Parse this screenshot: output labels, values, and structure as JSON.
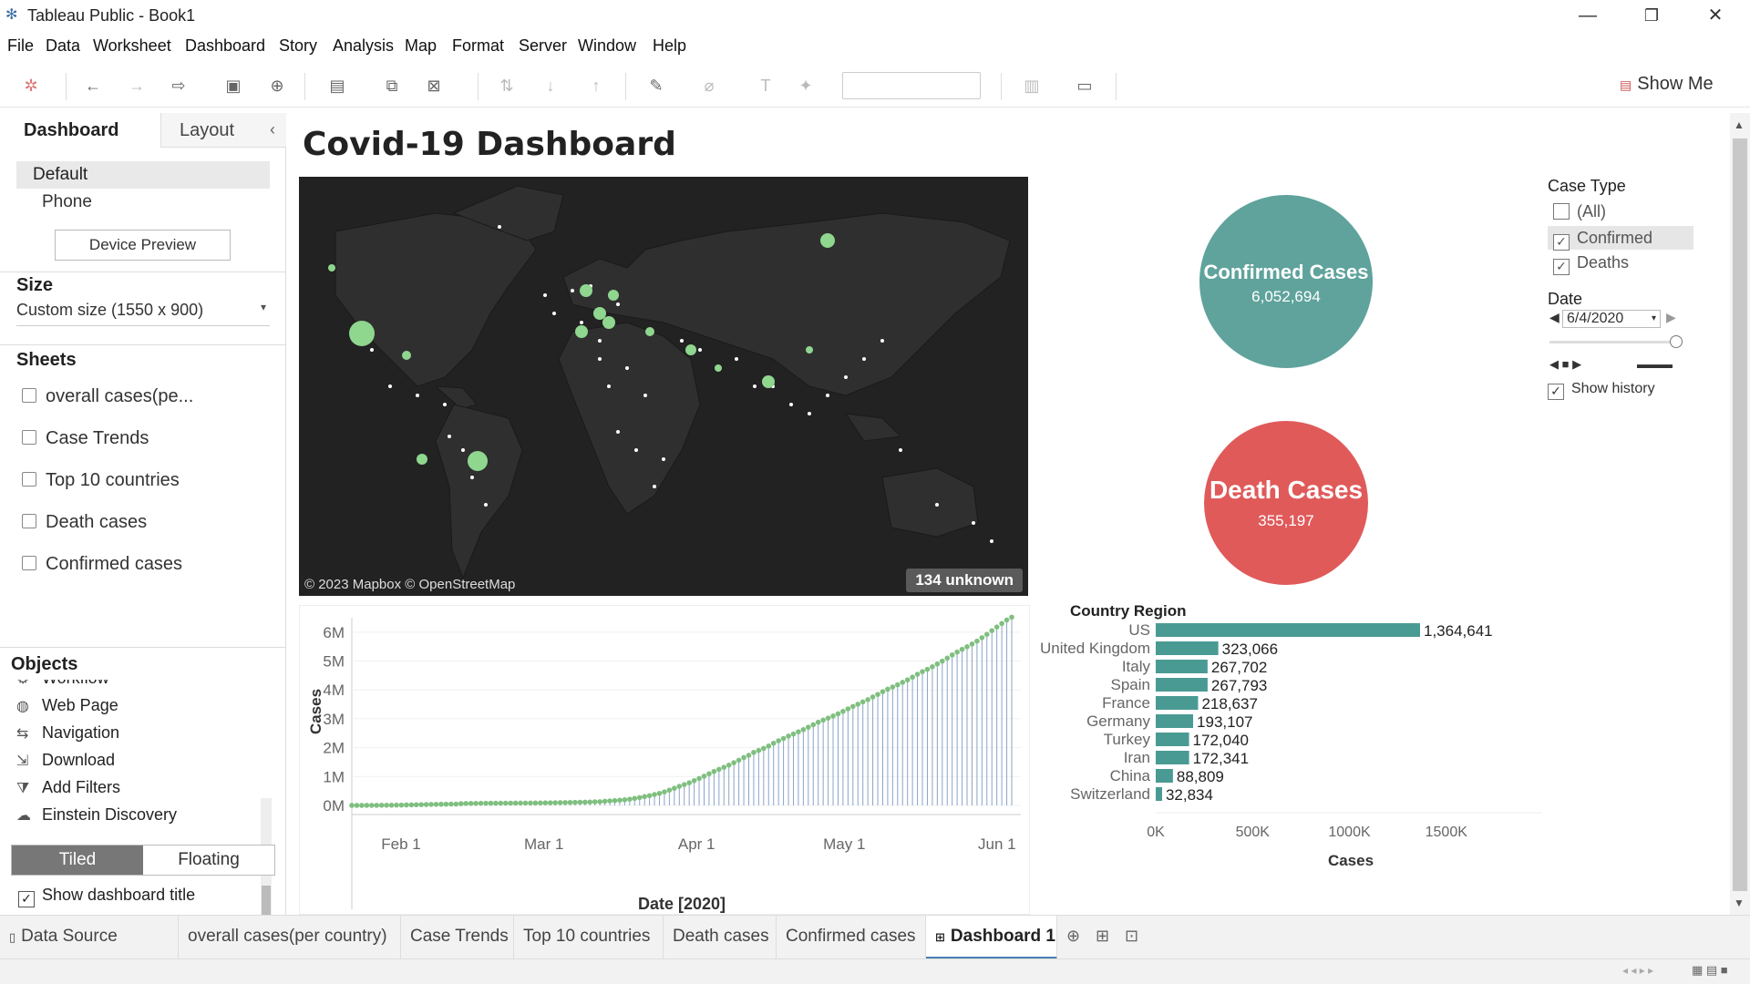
{
  "window": {
    "title": "Tableau Public - Book1",
    "minimize": "—",
    "restore": "❐",
    "close": "✕"
  },
  "menu": [
    "File",
    "Data",
    "Worksheet",
    "Dashboard",
    "Story",
    "Analysis",
    "Map",
    "Format",
    "Server",
    "Window",
    "Help"
  ],
  "toolbar": {
    "show_me": "Show Me"
  },
  "left_panel": {
    "tabs": {
      "dashboard": "Dashboard",
      "layout": "Layout",
      "collapse": "‹"
    },
    "devices": {
      "default": "Default",
      "phone": "Phone",
      "preview_button": "Device Preview"
    },
    "size": {
      "title": "Size",
      "value": "Custom size (1550 x 900)"
    },
    "sheets": {
      "title": "Sheets",
      "items": [
        "overall cases(pe...",
        "Case Trends",
        "Top 10 countries",
        "Death cases",
        "Confirmed cases"
      ]
    },
    "objects": {
      "title": "Objects",
      "items": [
        {
          "label": "Workflow",
          "icon": "workflow-icon"
        },
        {
          "label": "Web Page",
          "icon": "globe-icon"
        },
        {
          "label": "Navigation",
          "icon": "navigation-icon"
        },
        {
          "label": "Download",
          "icon": "download-icon"
        },
        {
          "label": "Add Filters",
          "icon": "filter-icon"
        },
        {
          "label": "Einstein Discovery",
          "icon": "einstein-icon"
        }
      ],
      "tiled": "Tiled",
      "floating": "Floating"
    },
    "show_title": {
      "label": "Show dashboard title",
      "checked": true
    }
  },
  "dashboard": {
    "title": "Covid-19 Dashboard",
    "map": {
      "attribution": "© 2023 Mapbox © OpenStreetMap",
      "unknown": "134 unknown"
    },
    "confirmed": {
      "label": "Confirmed Cases",
      "value": "6,052,694",
      "color": "#5fa39c"
    },
    "deaths": {
      "label": "Death Cases",
      "value": "355,197",
      "color": "#e05a5a"
    },
    "filters": {
      "case_type_title": "Case Type",
      "options": [
        {
          "label": "(All)",
          "checked": false
        },
        {
          "label": "Confirmed",
          "checked": true
        },
        {
          "label": "Deaths",
          "checked": true
        }
      ],
      "date_title": "Date",
      "date_value": "6/4/2020",
      "show_history": "Show history",
      "show_history_checked": true
    }
  },
  "chart_data": [
    {
      "type": "line",
      "ylabel": "Cases",
      "xlabel": "Date [2020]",
      "x_ticks": [
        "Feb 1",
        "Mar 1",
        "Apr 1",
        "May 1",
        "Jun 1"
      ],
      "y_ticks": [
        "0M",
        "1M",
        "2M",
        "3M",
        "4M",
        "5M",
        "6M"
      ],
      "ylim": [
        0,
        6500000
      ],
      "x_start": "2020-01-22",
      "x_end": "2020-06-04",
      "series": [
        {
          "color": "#7fbf7f",
          "values": [
            555,
            654,
            941,
            1434,
            2118,
            2927,
            5578,
            6166,
            8234,
            9927,
            12038,
            16787,
            19881,
            23892,
            27635,
            30817,
            34391,
            37120,
            40150,
            42762,
            44802,
            45221,
            60368,
            66885,
            69030,
            71224,
            73258,
            75136,
            75639,
            76197,
            76819,
            78572,
            78958,
            79561,
            80406,
            81388,
            82746,
            84112,
            86011,
            88369,
            90306,
            92840,
            95120,
            97886,
            101801,
            105847,
            109821,
            113590,
            118620,
            125875,
            128352,
            145205,
            156101,
            167454,
            181574,
            197102,
            214821,
            242570,
            272208,
            304507,
            336953,
            378235,
            418045,
            467653,
            529591,
            593291,
            660693,
            720140,
            782389,
            857487,
            932605,
            1013466,
            1095917,
            1176060,
            1249754,
            1321481,
            1396476,
            1479804,
            1565278,
            1657526,
            1735650,
            1834721,
            1904838,
            1976191,
            2056054,
            2152437,
            2240190,
            2317759,
            2401378,
            2472259,
            2549294,
            2624610,
            2708885,
            2795731,
            2881140,
            2955033,
            3023722,
            3097229,
            3172287,
            3256846,
            3343777,
            3427343,
            3506729,
            3583055,
            3662691,
            3755341,
            3845718,
            3938064,
            4024009,
            4101699,
            4177502,
            4261747,
            4347018,
            4442163,
            4542347,
            4634068,
            4713620,
            4801943,
            4897492,
            4996472,
            5102424,
            5210817,
            5310362,
            5407613,
            5495061,
            5589626,
            5691790,
            5808946,
            5924275,
            6052694,
            6180000,
            6300000,
            6420000,
            6520000
          ]
        }
      ]
    },
    {
      "type": "bar",
      "title": "Country Region",
      "xlabel": "Cases",
      "categories": [
        "US",
        "United Kingdom",
        "Italy",
        "Spain",
        "France",
        "Germany",
        "Turkey",
        "Iran",
        "China",
        "Switzerland"
      ],
      "values": [
        1364641,
        323066,
        267702,
        267793,
        218637,
        193107,
        172040,
        172341,
        88809,
        32834
      ],
      "value_labels": [
        "1,364,641",
        "323,066",
        "267,702",
        "267,793",
        "218,637",
        "193,107",
        "172,040",
        "172,341",
        "88,809",
        "32,834"
      ],
      "x_ticks": [
        "0K",
        "500K",
        "1000K",
        "1500K"
      ],
      "xlim": [
        0,
        1800000
      ],
      "color": "#4a9a94"
    }
  ],
  "bottom_tabs": [
    "Data Source",
    "overall cases(per country)",
    "Case Trends",
    "Top 10 countries",
    "Death cases",
    "Confirmed cases",
    "Dashboard 1"
  ]
}
